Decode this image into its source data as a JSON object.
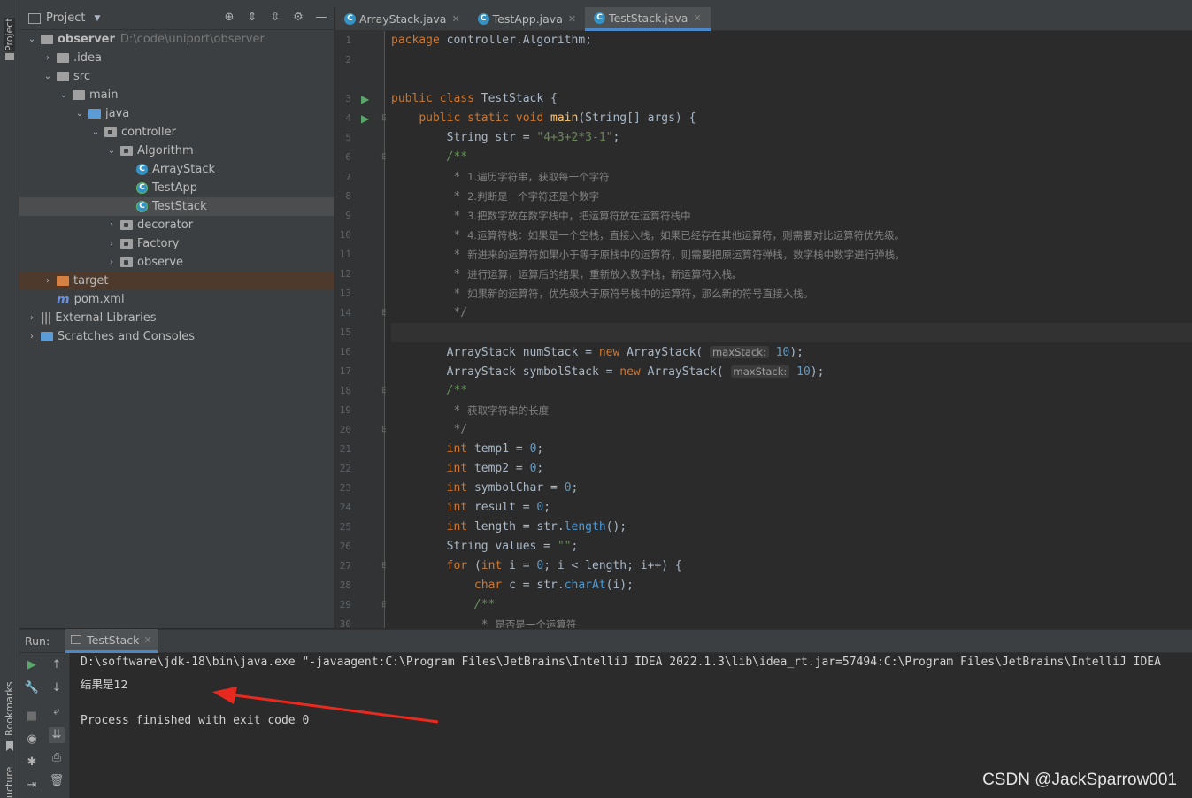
{
  "side_strip": {
    "project_label": "Project",
    "bookmarks_label": "Bookmarks",
    "structure_label": "ucture"
  },
  "project_panel": {
    "title": "Project"
  },
  "tree": [
    {
      "label": "observer",
      "path": "D:\\code\\uniport\\observer",
      "level": 0,
      "expanded": true,
      "kind": "root"
    },
    {
      "label": ".idea",
      "level": 1,
      "expanded": false,
      "kind": "folder"
    },
    {
      "label": "src",
      "level": 1,
      "expanded": true,
      "kind": "folder"
    },
    {
      "label": "main",
      "level": 2,
      "expanded": true,
      "kind": "folder"
    },
    {
      "label": "java",
      "level": 3,
      "expanded": true,
      "kind": "source"
    },
    {
      "label": "controller",
      "level": 4,
      "expanded": true,
      "kind": "package"
    },
    {
      "label": "Algorithm",
      "level": 5,
      "expanded": true,
      "kind": "package"
    },
    {
      "label": "ArrayStack",
      "level": 6,
      "kind": "class"
    },
    {
      "label": "TestApp",
      "level": 6,
      "kind": "runclass"
    },
    {
      "label": "TestStack",
      "level": 6,
      "kind": "runclass",
      "selected": true
    },
    {
      "label": "decorator",
      "level": 5,
      "expanded": false,
      "kind": "package"
    },
    {
      "label": "Factory",
      "level": 5,
      "expanded": false,
      "kind": "package"
    },
    {
      "label": "observe",
      "level": 5,
      "expanded": false,
      "kind": "package"
    },
    {
      "label": "target",
      "level": 1,
      "expanded": false,
      "kind": "target"
    },
    {
      "label": "pom.xml",
      "level": 1,
      "kind": "maven"
    },
    {
      "label": "External Libraries",
      "level": 0,
      "expanded": false,
      "kind": "libs"
    },
    {
      "label": "Scratches and Consoles",
      "level": 0,
      "expanded": false,
      "kind": "scratch"
    }
  ],
  "tabs": [
    {
      "label": "ArrayStack.java",
      "active": false
    },
    {
      "label": "TestApp.java",
      "active": false
    },
    {
      "label": "TestStack.java",
      "active": true
    }
  ],
  "code_lines": [
    {
      "n": "1",
      "html": "<span class=\"kw\">package </span>controller.Algorithm;"
    },
    {
      "n": "2",
      "html": ""
    },
    {
      "n": "",
      "html": ""
    },
    {
      "n": "3",
      "html": "<span class=\"kw\">public class </span>TestStack {",
      "run": true
    },
    {
      "n": "4",
      "html": "    <span class=\"kw\">public static void </span><span class=\"fn\">main</span>(String[] args) {",
      "run": true,
      "fold": true
    },
    {
      "n": "5",
      "html": "        String str = <span class=\"str\">\"4+3+2*3-1\"</span>;"
    },
    {
      "n": "6",
      "html": "        <span class=\"cm\">/**</span>",
      "fold": true
    },
    {
      "n": "7",
      "html": "         <span class=\"cmt\">* </span><span class=\"cmcn\">1.遍历字符串，获取每一个字符</span>"
    },
    {
      "n": "8",
      "html": "         <span class=\"cmt\">* </span><span class=\"cmcn\">2.判断是一个字符还是个数字</span>"
    },
    {
      "n": "9",
      "html": "         <span class=\"cmt\">* </span><span class=\"cmcn\">3.把数字放在数字栈中，把运算符放在运算符栈中</span>"
    },
    {
      "n": "10",
      "html": "         <span class=\"cmt\">* </span><span class=\"cmcn\">4.运算符栈：如果是一个空栈，直接入栈，如果已经存在其他运算符，则需要对比运算符优先级。</span>"
    },
    {
      "n": "11",
      "html": "         <span class=\"cmt\">* </span><span class=\"cmcn\">新进来的运算符如果小于等于原栈中的运算符，则需要把原运算符弹栈，数字栈中数字进行弹栈，</span>"
    },
    {
      "n": "12",
      "html": "         <span class=\"cmt\">* </span><span class=\"cmcn\">进行运算，运算后的结果，重新放入数字栈，新运算符入栈。</span>"
    },
    {
      "n": "13",
      "html": "         <span class=\"cmt\">* </span><span class=\"cmcn\">如果新的运算符，优先级大于原符号栈中的运算符，那么新的符号直接入栈。</span>"
    },
    {
      "n": "14",
      "html": "         <span class=\"cmt\">*/</span>",
      "fold": true
    },
    {
      "n": "15",
      "html": "",
      "hl": true
    },
    {
      "n": "16",
      "html": "        ArrayStack numStack = <span class=\"kw\">new </span>ArrayStack( <span class=\"hint\">maxStack:</span> <span class=\"num\">10</span>);"
    },
    {
      "n": "17",
      "html": "        ArrayStack symbolStack = <span class=\"kw\">new </span>ArrayStack( <span class=\"hint\">maxStack:</span> <span class=\"num\">10</span>);"
    },
    {
      "n": "18",
      "html": "        <span class=\"cm\">/**</span>",
      "fold": true
    },
    {
      "n": "19",
      "html": "         <span class=\"cmt\">* </span><span class=\"cmcn\">获取字符串的长度</span>"
    },
    {
      "n": "20",
      "html": "         <span class=\"cmt\">*/</span>",
      "fold": true
    },
    {
      "n": "21",
      "html": "        <span class=\"kw\">int </span>temp1 = <span class=\"num\">0</span>;"
    },
    {
      "n": "22",
      "html": "        <span class=\"kw\">int </span>temp2 = <span class=\"num\">0</span>;"
    },
    {
      "n": "23",
      "html": "        <span class=\"kw\">int </span>symbolChar = <span class=\"num\">0</span>;"
    },
    {
      "n": "24",
      "html": "        <span class=\"kw\">int </span>result = <span class=\"num\">0</span>;"
    },
    {
      "n": "25",
      "html": "        <span class=\"kw\">int </span>length = str.<span class=\"mcall\">length</span>();"
    },
    {
      "n": "26",
      "html": "        String values = <span class=\"str\">\"\"</span>;"
    },
    {
      "n": "27",
      "html": "        <span class=\"kw\">for </span>(<span class=\"kw\">int </span>i = <span class=\"num\">0</span>; i &lt; length; i++) {",
      "fold": true
    },
    {
      "n": "28",
      "html": "            <span class=\"kw\">char </span>c = str.<span class=\"mcall\">charAt</span>(i);"
    },
    {
      "n": "29",
      "html": "            <span class=\"cm\">/**</span>",
      "fold": true
    },
    {
      "n": "30",
      "html": "             <span class=\"cmt\">* </span><span class=\"cmcn\">是否是一个运算符</span>"
    }
  ],
  "run_panel": {
    "label": "Run:",
    "tab": "TestStack"
  },
  "console": {
    "command": "D:\\software\\jdk-18\\bin\\java.exe \"-javaagent:C:\\Program Files\\JetBrains\\IntelliJ IDEA 2022.1.3\\lib\\idea_rt.jar=57494:C:\\Program Files\\JetBrains\\IntelliJ IDEA",
    "output": "结果是12",
    "exit": "Process finished with exit code 0"
  },
  "annotation": {
    "arrow_color": "#e8291f"
  },
  "watermark": "CSDN @JackSparrow001",
  "colors": {
    "keyword": "#cc7832",
    "string": "#6a8759",
    "number": "#6897bb",
    "doc_comment": "#629755",
    "method": "#ffc66d",
    "accent": "#4a88c7"
  }
}
